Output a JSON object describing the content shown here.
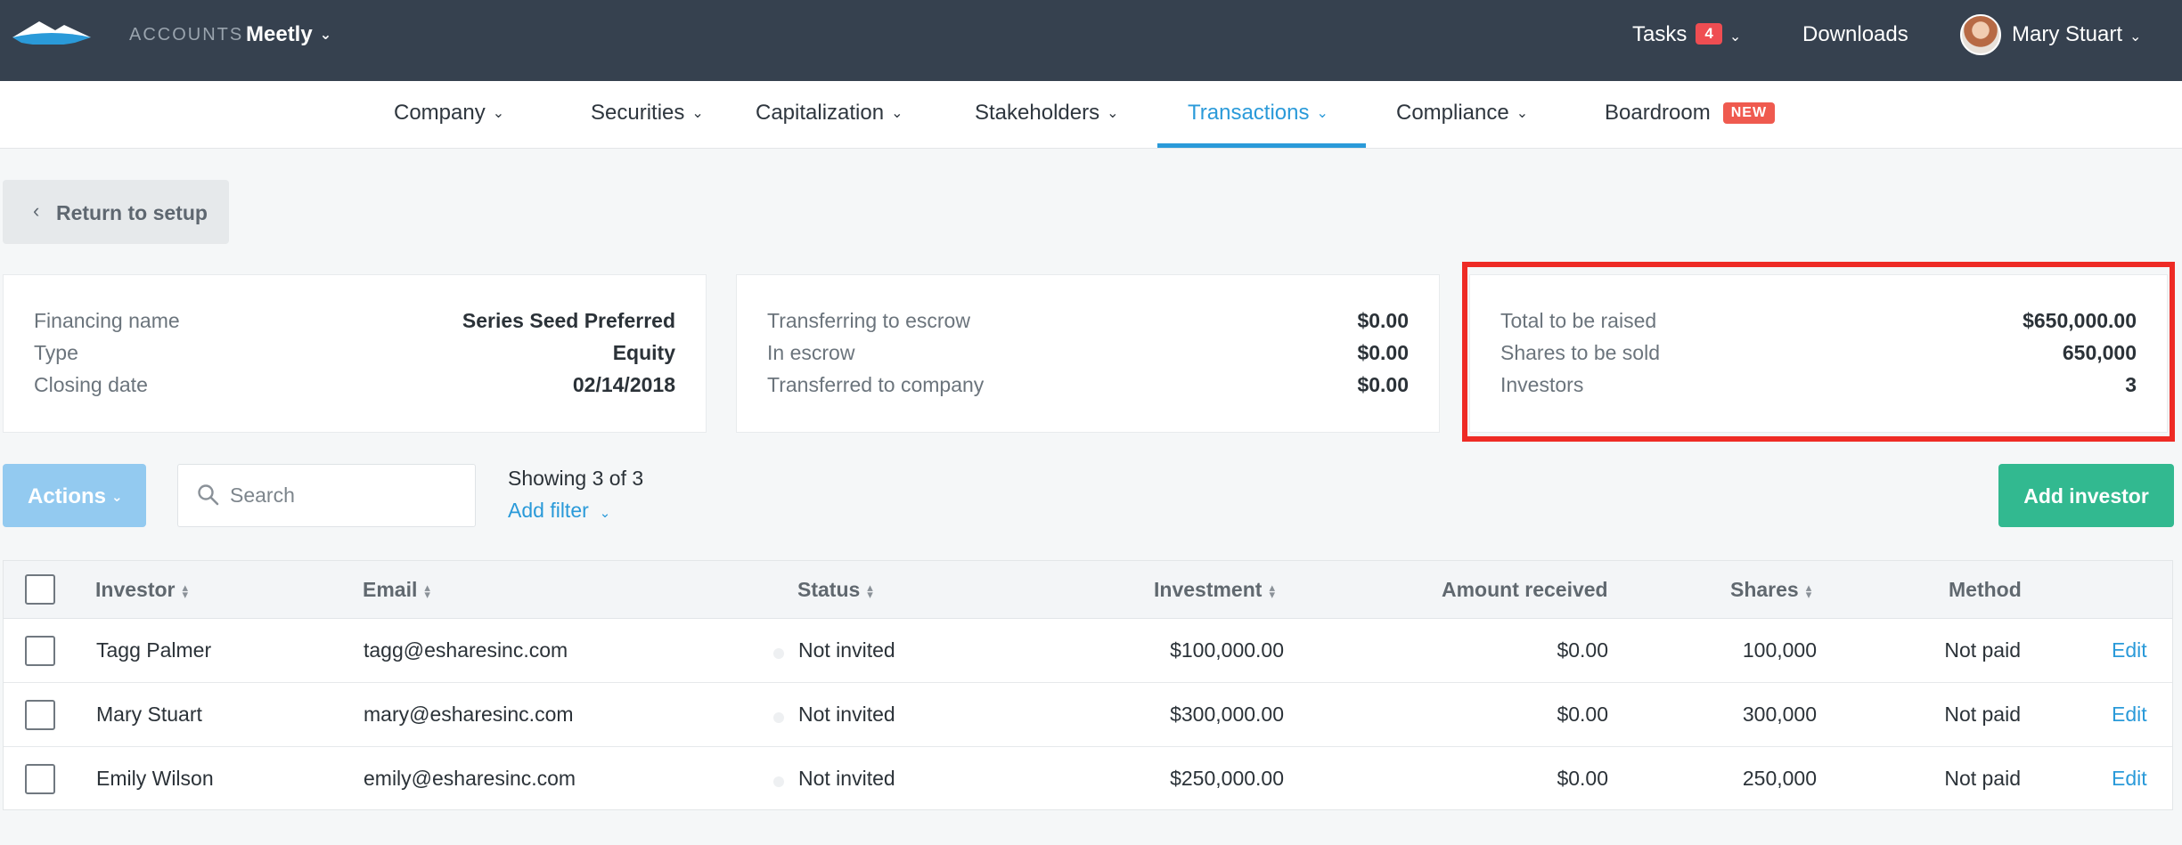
{
  "topbar": {
    "accounts_label": "ACCOUNTS",
    "org_name": "Meetly",
    "tasks_label": "Tasks",
    "tasks_count": "4",
    "downloads_label": "Downloads",
    "user_name": "Mary Stuart"
  },
  "nav": {
    "items": [
      {
        "label": "Company"
      },
      {
        "label": "Securities"
      },
      {
        "label": "Capitalization"
      },
      {
        "label": "Stakeholders"
      },
      {
        "label": "Transactions",
        "active": true
      },
      {
        "label": "Compliance"
      },
      {
        "label": "Boardroom",
        "badge": "NEW"
      }
    ]
  },
  "return_label": "Return to setup",
  "summary": {
    "financing": [
      {
        "key": "Financing name",
        "value": "Series Seed Preferred"
      },
      {
        "key": "Type",
        "value": "Equity"
      },
      {
        "key": "Closing date",
        "value": "02/14/2018"
      }
    ],
    "escrow": [
      {
        "key": "Transferring to escrow",
        "value": "$0.00"
      },
      {
        "key": "In escrow",
        "value": "$0.00"
      },
      {
        "key": "Transferred to company",
        "value": "$0.00"
      }
    ],
    "totals": [
      {
        "key": "Total to be raised",
        "value": "$650,000.00"
      },
      {
        "key": "Shares to be sold",
        "value": "650,000"
      },
      {
        "key": "Investors",
        "value": "3"
      }
    ]
  },
  "toolbar": {
    "actions_label": "Actions",
    "search_placeholder": "Search",
    "showing_text": "Showing 3 of 3",
    "add_filter_label": "Add filter",
    "add_investor_label": "Add investor"
  },
  "table": {
    "headers": {
      "investor": "Investor",
      "email": "Email",
      "status": "Status",
      "investment": "Investment",
      "amount_received": "Amount received",
      "shares": "Shares",
      "method": "Method"
    },
    "rows": [
      {
        "investor": "Tagg Palmer",
        "email": "tagg@esharesinc.com",
        "status": "Not invited",
        "investment": "$100,000.00",
        "amount_received": "$0.00",
        "shares": "100,000",
        "method": "Not paid",
        "action": "Edit"
      },
      {
        "investor": "Mary Stuart",
        "email": "mary@esharesinc.com",
        "status": "Not invited",
        "investment": "$300,000.00",
        "amount_received": "$0.00",
        "shares": "300,000",
        "method": "Not paid",
        "action": "Edit"
      },
      {
        "investor": "Emily Wilson",
        "email": "emily@esharesinc.com",
        "status": "Not invited",
        "investment": "$250,000.00",
        "amount_received": "$0.00",
        "shares": "250,000",
        "method": "Not paid",
        "action": "Edit"
      }
    ]
  },
  "colors": {
    "topbar": "#36414f",
    "accent": "#2a9ad9",
    "primary_action": "#32b990",
    "highlight": "#ee2b25"
  },
  "icons": [
    "logo-mountain-icon",
    "chevron-down-icon",
    "chevron-left-icon",
    "search-icon",
    "sort-icon",
    "avatar"
  ]
}
